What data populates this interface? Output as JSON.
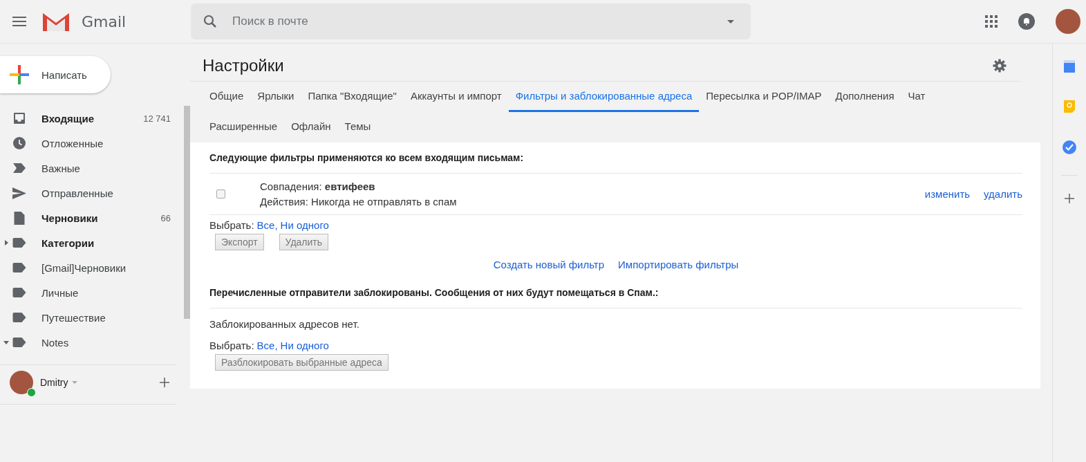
{
  "header": {
    "logo_text": "Gmail",
    "search": {
      "placeholder": "Поиск в почте"
    }
  },
  "compose": {
    "label": "Написать"
  },
  "sidebar": {
    "items": [
      {
        "kind": "inbox",
        "label": "Входящие",
        "count": "12 741",
        "unread": true
      },
      {
        "kind": "snoozed",
        "label": "Отложенные",
        "unread": false
      },
      {
        "kind": "important",
        "label": "Важные",
        "unread": false
      },
      {
        "kind": "sent",
        "label": "Отправленные",
        "unread": false
      },
      {
        "kind": "drafts",
        "label": "Черновики",
        "count": "66",
        "unread": true
      },
      {
        "kind": "label",
        "label": "Категории",
        "unread": true,
        "expanded": false
      },
      {
        "kind": "label",
        "label": "[Gmail]Черновики",
        "unread": false
      },
      {
        "kind": "label",
        "label": "Личные",
        "unread": false
      },
      {
        "kind": "label",
        "label": "Путешествие",
        "unread": false
      },
      {
        "kind": "label",
        "label": "Notes",
        "unread": false,
        "expanded": true
      }
    ],
    "user": {
      "name": "Dmitry",
      "online": true
    }
  },
  "settings": {
    "title": "Настройки",
    "tabs": [
      {
        "label": "Общие",
        "selected": false
      },
      {
        "label": "Ярлыки",
        "selected": false
      },
      {
        "label": "Папка \"Входящие\"",
        "selected": false
      },
      {
        "label": "Аккаунты и импорт",
        "selected": false
      },
      {
        "label": "Фильтры и заблокированные адреса",
        "selected": true
      },
      {
        "label": "Пересылка и POP/IMAP",
        "selected": false
      },
      {
        "label": "Дополнения",
        "selected": false
      },
      {
        "label": "Чат",
        "selected": false
      },
      {
        "label": "Расширенные",
        "selected": false
      },
      {
        "label": "Офлайн",
        "selected": false
      },
      {
        "label": "Темы",
        "selected": false
      }
    ]
  },
  "filters": {
    "heading": "Следующие фильтры применяются ко всем входящим письмам:",
    "rows": [
      {
        "checked": false,
        "match": "Совпадения: **евтифеев**",
        "action": "Действия: Никогда не отправлять в спам",
        "links": [
          "изменить",
          "удалить"
        ]
      }
    ],
    "select_label": "Выбрать:",
    "select_links": [
      "Все,",
      "Ни одного"
    ],
    "buttons": [
      "Экспорт",
      "Удалить"
    ],
    "create_links": [
      "Создать новый фильтр",
      "Импортировать фильтры"
    ]
  },
  "blocked": {
    "heading": "Перечисленные отправители заблокированы. Сообщения от них будут помещаться в Спам.:",
    "empty_text": "Заблокированных адресов нет.",
    "select_label": "Выбрать:",
    "select_links": [
      "Все,",
      "Ни одного"
    ],
    "button": "Разблокировать выбранные адреса"
  }
}
